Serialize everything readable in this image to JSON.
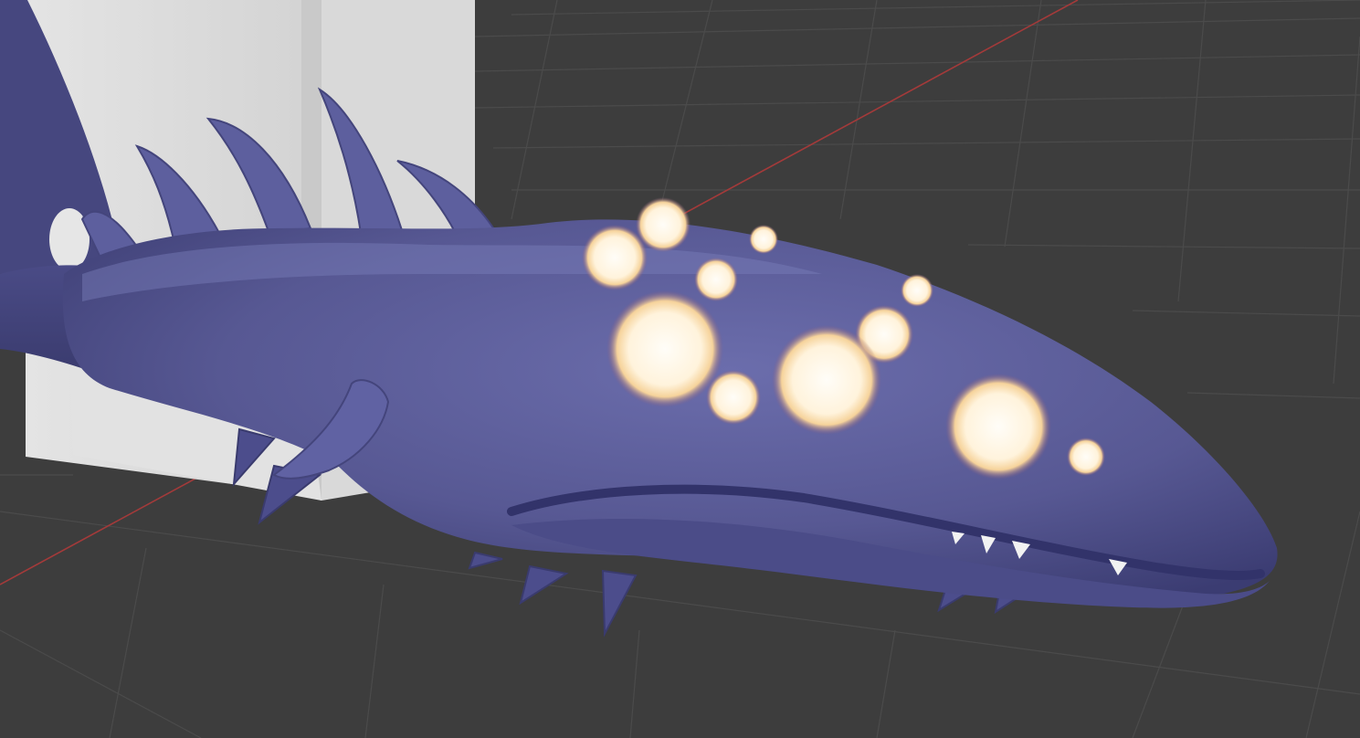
{
  "scene": {
    "kind": "3d-viewport-render",
    "subject": "creature-model",
    "colors": {
      "background": "#3d3d3d",
      "grid_line": "#4b4b4b",
      "axis_x": "#a33a3a",
      "box_light": "#dcdcdc",
      "box_shadow": "#b8b8b8",
      "skin": "#5a5b9a",
      "skin_dark": "#3e3f78",
      "skin_light": "#7c7fbc",
      "glow_core": "#fff6e6",
      "glow_halo": "#f1c989",
      "teeth": "#f2f2f2"
    }
  }
}
